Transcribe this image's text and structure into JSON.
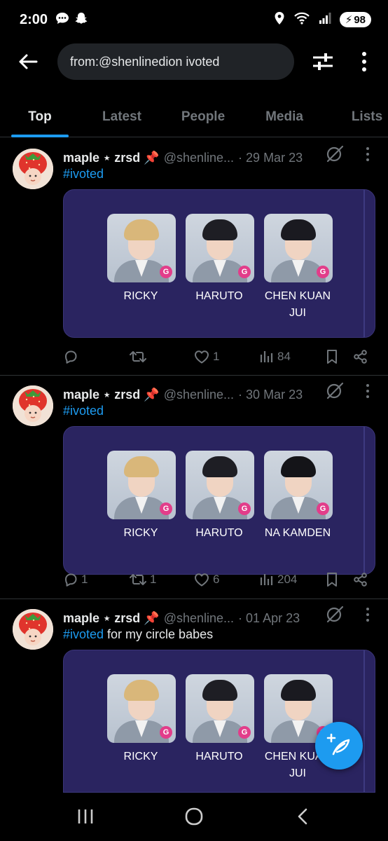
{
  "status_bar": {
    "time": "2:00",
    "battery": "98"
  },
  "search": {
    "query": "from:@shenlinedion ivoted"
  },
  "tabs": [
    {
      "label": "Top",
      "active": true
    },
    {
      "label": "Latest",
      "active": false
    },
    {
      "label": "People",
      "active": false
    },
    {
      "label": "Media",
      "active": false
    },
    {
      "label": "Lists",
      "active": false
    }
  ],
  "tweets": [
    {
      "name": "maple ⋆ zrsd 📌",
      "handle": "@shenline...",
      "date": "· 29 Mar 23",
      "hashtag": "#ivoted",
      "text": "",
      "people": [
        {
          "name": "RICKY",
          "hair": "#d9b77a"
        },
        {
          "name": "HARUTO",
          "hair": "#1e1e24"
        },
        {
          "name": "CHEN KUAN JUI",
          "hair": "#1a1a20"
        }
      ],
      "replies": "",
      "reposts": "",
      "likes": "1",
      "views": "84"
    },
    {
      "name": "maple ⋆ zrsd 📌",
      "handle": "@shenline...",
      "date": "· 30 Mar 23",
      "hashtag": "#ivoted",
      "text": "",
      "people": [
        {
          "name": "RICKY",
          "hair": "#d9b77a"
        },
        {
          "name": "HARUTO",
          "hair": "#1e1e24"
        },
        {
          "name": "NA KAMDEN",
          "hair": "#141418"
        }
      ],
      "replies": "1",
      "reposts": "1",
      "likes": "6",
      "views": "204"
    },
    {
      "name": "maple ⋆ zrsd 📌",
      "handle": "@shenline...",
      "date": "· 01 Apr 23",
      "hashtag": "#ivoted",
      "text": " for my circle babes",
      "people": [
        {
          "name": "RICKY",
          "hair": "#d9b77a"
        },
        {
          "name": "HARUTO",
          "hair": "#1e1e24"
        },
        {
          "name": "CHEN KUAN JUI",
          "hair": "#1a1a20"
        }
      ],
      "replies": "",
      "reposts": "",
      "likes": "",
      "views": ""
    }
  ],
  "colors": {
    "accent": "#1d9bf0",
    "card_bg": "#2a2460",
    "background": "#000000"
  },
  "icons": {
    "back": "arrow-left-icon",
    "filter": "sliders-icon",
    "more": "more-vertical-icon",
    "compose": "feather-plus-icon"
  }
}
